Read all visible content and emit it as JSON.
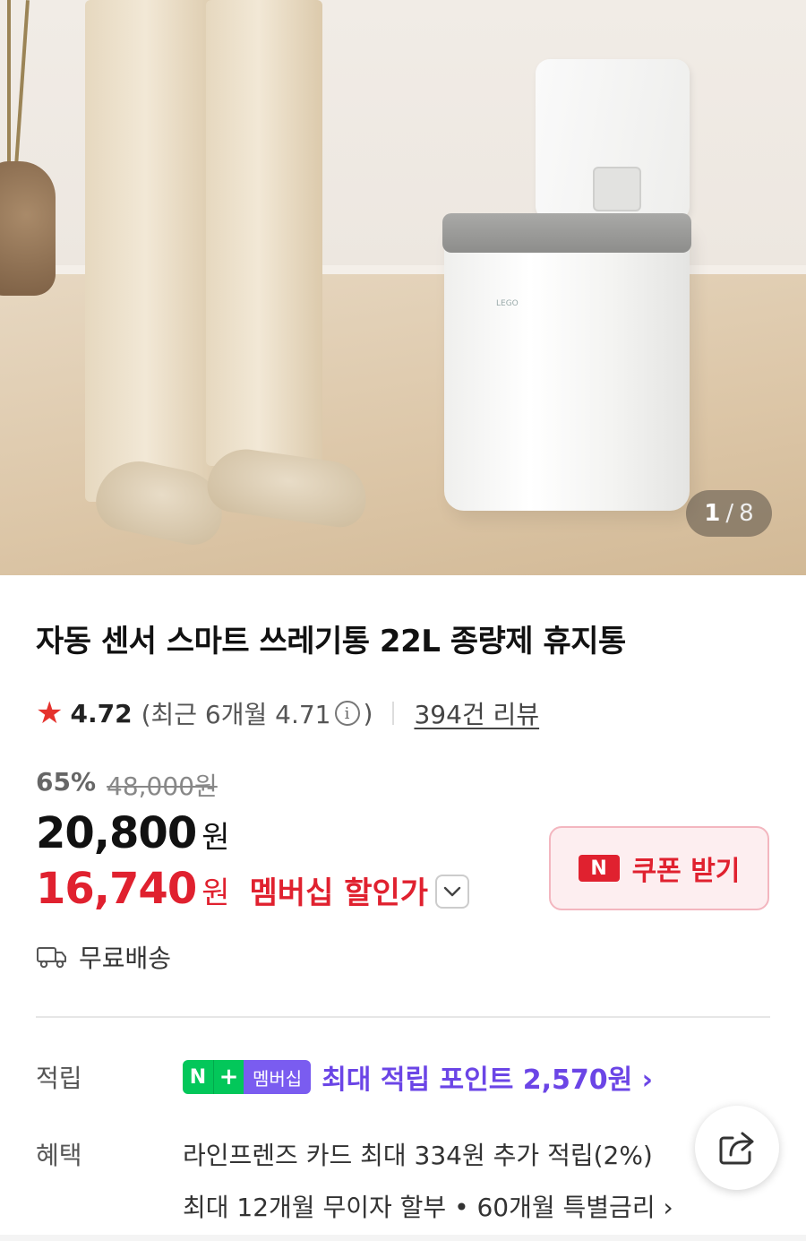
{
  "gallery": {
    "current": "1",
    "separator": "/",
    "total": "8",
    "brand_mark": "LEGO"
  },
  "product": {
    "title": "자동 센서 스마트 쓰레기통 22L 종량제 휴지통"
  },
  "rating": {
    "score": "4.72",
    "recent": "(최근 6개월 4.71",
    "recent_close": ")",
    "info_symbol": "i",
    "reviews": "394건 리뷰"
  },
  "price": {
    "discount_rate": "65%",
    "original": "48,000원",
    "sale": "20,800",
    "sale_unit": "원",
    "member": "16,740",
    "member_unit": "원",
    "member_label": "멤버십 할인가"
  },
  "coupon": {
    "badge": "N",
    "label": "쿠폰 받기"
  },
  "shipping": {
    "label": "무료배송"
  },
  "points": {
    "row_label": "적립",
    "badge_n": "N",
    "badge_plus": "+",
    "badge_membership": "멤버십",
    "text": "최대 적립 포인트 2,570원 ›"
  },
  "benefits": {
    "row_label": "혜택",
    "line1": "라인프렌즈 카드 최대 334원 추가 적립(2%)",
    "line2": "최대 12개월 무이자 할부 • 60개월 특별금리 ›"
  },
  "colors": {
    "accent_red": "#e0212f",
    "naver_green": "#03c75a",
    "membership_purple": "#6b45e6"
  },
  "icons": [
    "star-icon",
    "info-icon",
    "chevron-down-icon",
    "truck-icon",
    "share-icon"
  ]
}
